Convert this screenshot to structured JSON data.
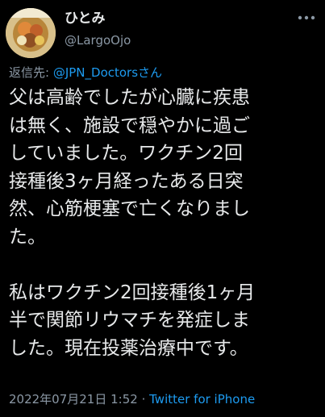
{
  "author": {
    "display_name": "ひとみ",
    "handle": "@LargoOjo"
  },
  "reply_to": {
    "prefix": "返信先: ",
    "mention": "@JPN_Doctorsさん"
  },
  "tweet": {
    "lines_para1": [
      "父は高齢でしたが心臓に疾患",
      "は無く、施設で穏やかに過ご",
      "していました。ワクチン2回",
      "接種後3ヶ月経ったある日突",
      "然、心筋梗塞で亡くなりまし",
      "た。"
    ],
    "lines_para2": [
      "私はワクチン2回接種後1ヶ月",
      "半で関節リウマチを発症しま",
      "した。現在投薬治療中です。"
    ]
  },
  "meta": {
    "timestamp": "2022年07月21日 1:52",
    "separator": " · ",
    "source": "Twitter for iPhone"
  },
  "icons": {
    "avatar": "avatar-photo",
    "more": "more-options-icon"
  },
  "colors": {
    "background": "#000000",
    "text_primary": "#e7e9ea",
    "text_secondary": "#8b98a5",
    "link": "#1d9bf0"
  }
}
